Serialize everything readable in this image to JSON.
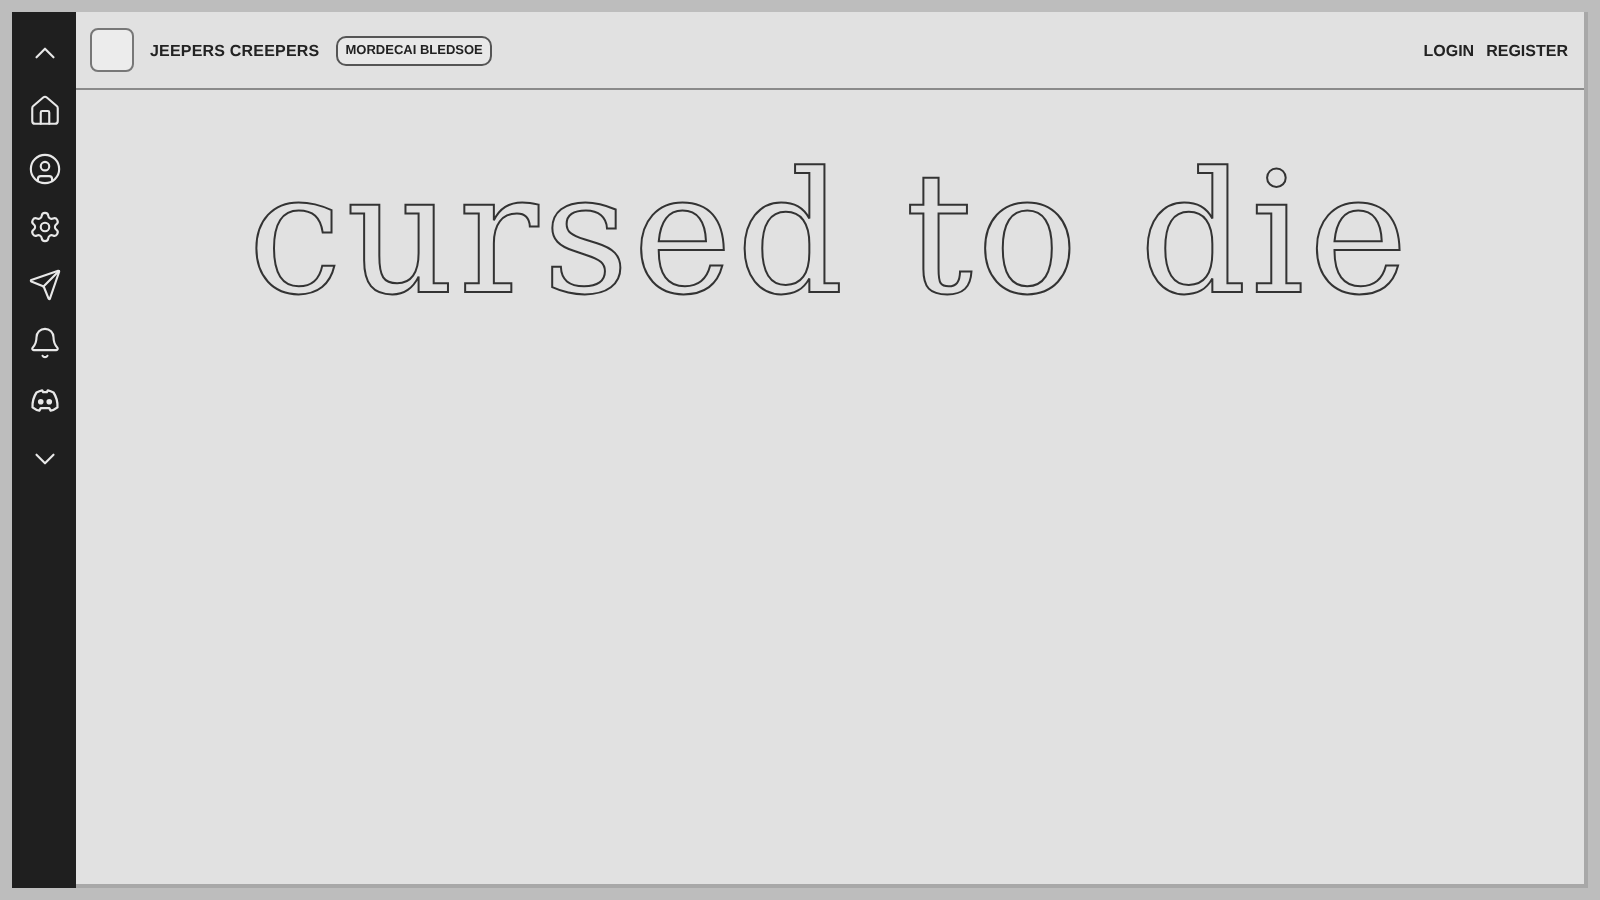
{
  "header": {
    "title": "JEEPERS CREEPERS",
    "tag": "MORDECAI BLEDSOE",
    "links": [
      "LOGIN",
      "REGISTER"
    ]
  },
  "headline": "cursed to die"
}
